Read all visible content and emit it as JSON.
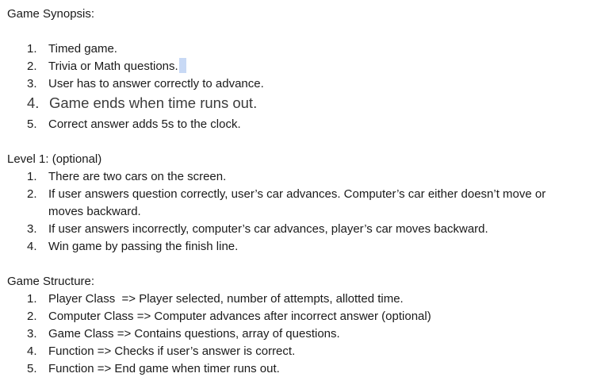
{
  "sections": {
    "synopsis": {
      "title": "Game Synopsis:",
      "items": [
        {
          "num": "1.",
          "text": "Timed game."
        },
        {
          "num": "2.",
          "text": "Trivia or Math questions."
        },
        {
          "num": "3.",
          "text": "User has to answer correctly to advance."
        },
        {
          "num": "4.",
          "text": "Game ends when time runs out."
        },
        {
          "num": "5.",
          "text": "Correct answer adds 5s to the clock."
        }
      ]
    },
    "level1": {
      "title": "Level 1: (optional)",
      "items": [
        {
          "num": "1.",
          "text": "There are two cars on the screen."
        },
        {
          "num": "2.",
          "text": "If user answers question correctly, user’s car advances. Computer’s car either doesn’t move or moves backward."
        },
        {
          "num": "3.",
          "text": "If user answers incorrectly, computer’s car advances, player’s car moves backward."
        },
        {
          "num": "4.",
          "text": "Win game by passing the finish line."
        }
      ]
    },
    "structure": {
      "title": "Game Structure:",
      "items": [
        {
          "num": "1.",
          "text": "Player Class  => Player selected, number of attempts, allotted time."
        },
        {
          "num": "2.",
          "text": "Computer Class => Computer advances after incorrect answer (optional)"
        },
        {
          "num": "3.",
          "text": "Game Class => Contains questions, array of questions."
        },
        {
          "num": "4.",
          "text": "Function => Checks if user’s answer is correct."
        },
        {
          "num": "5.",
          "text": "Function => End game when timer runs out."
        }
      ]
    }
  },
  "colors": {
    "text": "#1a1a1a",
    "large_item_text": "#3c3c3c",
    "selection": "#c8d9f5"
  }
}
